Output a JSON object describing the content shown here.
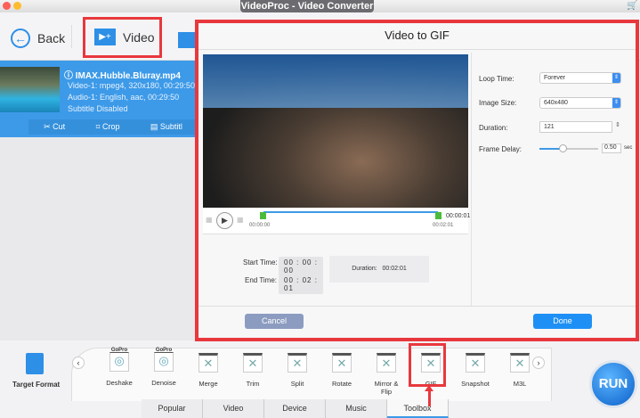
{
  "window": {
    "title": "VideoProc - Video Converter"
  },
  "toolbar": {
    "back_label": "Back",
    "video_label": "Video"
  },
  "file": {
    "name": "IMAX.Hubble.Bluray.mp4",
    "video": "Video-1: mpeg4, 320x180, 00:29:50",
    "audio": "Audio-1: English, aac, 00:29:50",
    "subtitle": "Subtitle Disabled",
    "actions": [
      "Cut",
      "Crop",
      "Subtitl"
    ]
  },
  "dialog": {
    "title": "Video to GIF",
    "timeline": {
      "start": "00:00:00",
      "end": "00:02:01",
      "total": "00:00:01"
    },
    "start_time_label": "Start Time:",
    "start_time": [
      "00",
      "00",
      "00"
    ],
    "end_time_label": "End Time:",
    "end_time": [
      "00",
      "02",
      "01"
    ],
    "duration_label": "Duration:",
    "duration_value": "00:02:01",
    "settings": {
      "loop_label": "Loop Time:",
      "loop_value": "Forever",
      "size_label": "Image Size:",
      "size_value": "640x480",
      "duration_label": "Duration:",
      "duration_value": "121",
      "delay_label": "Frame Delay:",
      "delay_value": "0.50",
      "delay_unit": "sec",
      "delay_slider_fraction": 0.4
    },
    "cancel": "Cancel",
    "done": "Done"
  },
  "bottom": {
    "target_format": "Target Format",
    "gopro": "GoPro",
    "tools": [
      "Deshake",
      "Denoise",
      "Merge",
      "Trim",
      "Split",
      "Rotate",
      "Mirror & Flip",
      "GIF",
      "Snapshot",
      "M3L"
    ],
    "tabs": [
      "Popular",
      "Video",
      "Device",
      "Music",
      "Toolbox"
    ],
    "active_tab": "Toolbox",
    "run": "RUN"
  },
  "colors": {
    "accent": "#3d9ae8",
    "highlight": "#e8383d",
    "green": "#4cbb3c"
  }
}
